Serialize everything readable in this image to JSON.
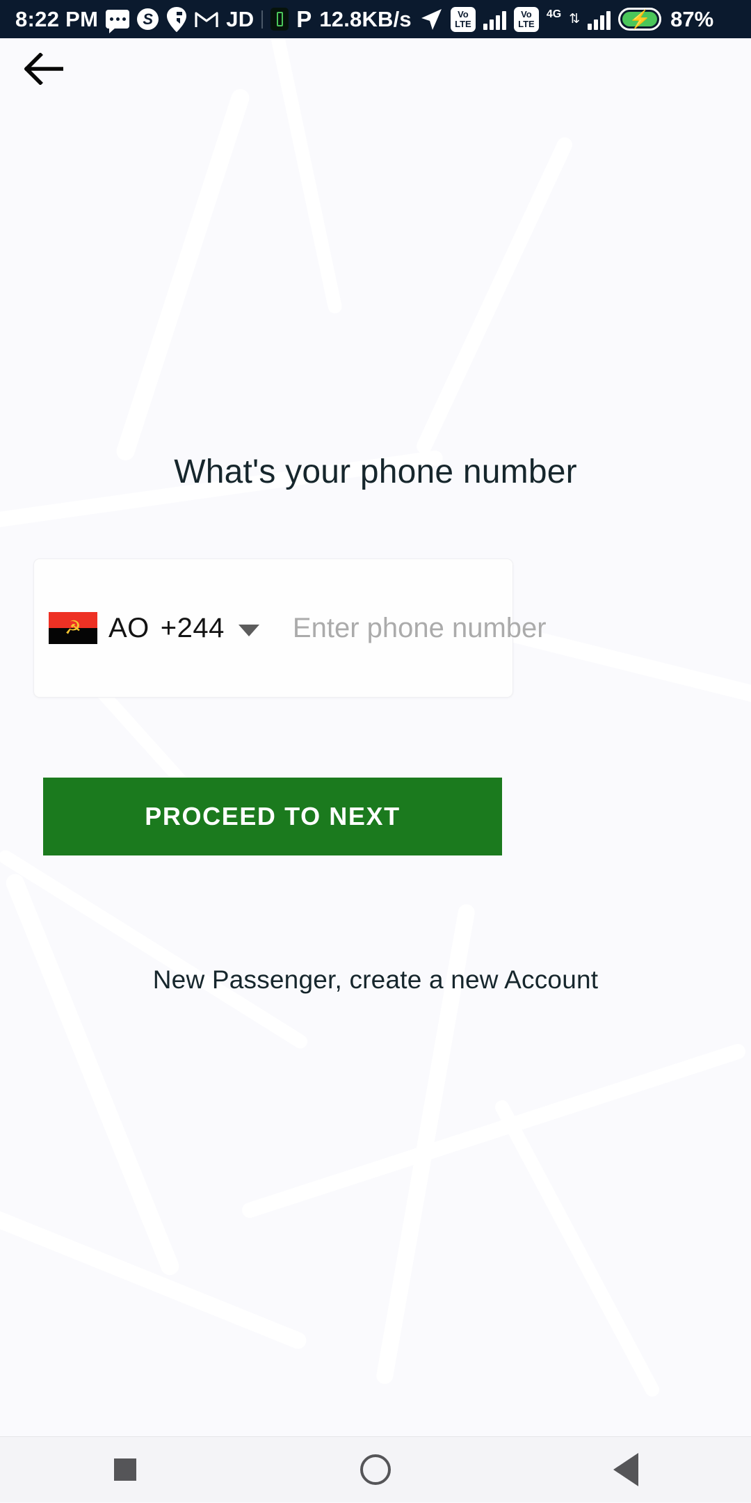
{
  "status_bar": {
    "time": "8:22 PM",
    "network_speed": "12.8KB/s",
    "battery_percent": "87%",
    "sim1_network": "VoLTE",
    "sim2_network": "VoLTE",
    "data_network": "4G",
    "icons": [
      "chat-bubble-icon",
      "skype-icon",
      "swiggy-icon",
      "gmail-icon",
      "jd-icon",
      "battery-saver-icon",
      "paytm-icon",
      "location-arrow-icon",
      "volte-icon",
      "signal-bars-icon",
      "volte-icon",
      "data-transfer-icon",
      "signal-bars-icon",
      "charging-battery-icon"
    ],
    "labels": {
      "skype": "S",
      "gmail": "M",
      "jd": "JD",
      "paytm": "P",
      "volte_top": "Vo",
      "volte_bottom": "LTE",
      "fourg": "4G",
      "updown": "⇅"
    },
    "background_color": "#0B1A2E",
    "text_color": "#FFFFFF",
    "battery_fill_color": "#4BC65A"
  },
  "nav": {
    "back_icon": "back-arrow-icon"
  },
  "main": {
    "title": "What's your phone number",
    "country": {
      "iso_code": "AO",
      "dial_code": "+244",
      "flag_name": "angola-flag-icon",
      "flag_top_color": "#EE3124",
      "flag_bottom_color": "#050505",
      "flag_emblem_color": "#F4C430",
      "flag_emblem_glyph": "☭",
      "dropdown_icon": "chevron-down-icon"
    },
    "phone_input": {
      "placeholder": "Enter phone number",
      "value": ""
    },
    "proceed_button": {
      "label": "PROCEED TO NEXT",
      "color": "#1B7A1E",
      "text_color": "#FFFFFF"
    },
    "signup_link": "New Passenger, create a new Account"
  },
  "system_nav": {
    "recents_icon": "square-recents-icon",
    "home_icon": "circle-home-icon",
    "back_icon": "triangle-back-icon",
    "icon_color": "#555558"
  }
}
